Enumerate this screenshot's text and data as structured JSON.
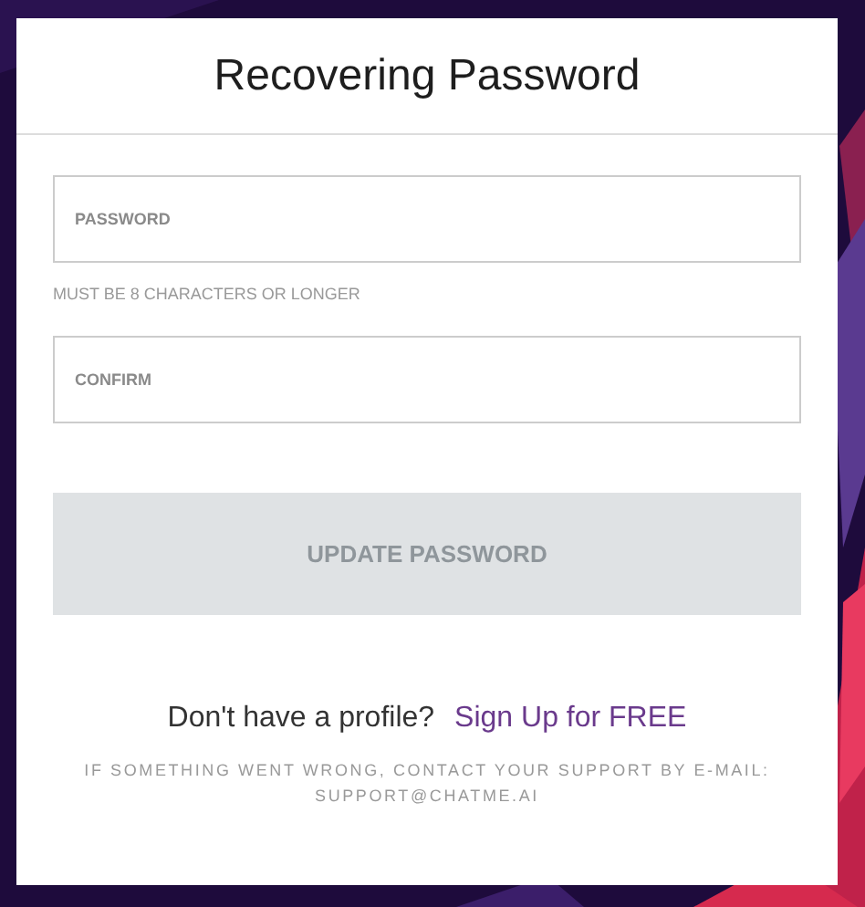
{
  "title": "Recovering Password",
  "fields": [
    {
      "placeholder": "PASSWORD",
      "hint": "MUST BE 8 CHARACTERS OR LONGER"
    },
    {
      "placeholder": "CONFIRM"
    }
  ],
  "button": {
    "label": "UPDATE PASSWORD",
    "disabled": true
  },
  "signup": {
    "prompt": "Don't have a profile?",
    "link": "Sign Up for FREE"
  },
  "support": [
    "IF SOMETHING WENT WRONG, CONTACT YOUR SUPPORT BY E-MAIL:",
    "SUPPORT@CHATME.AI"
  ]
}
